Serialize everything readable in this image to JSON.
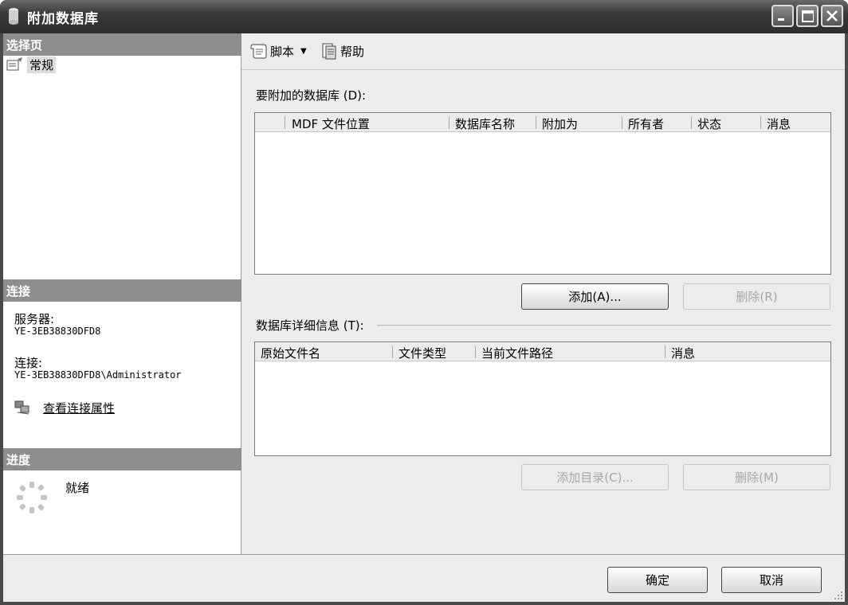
{
  "window": {
    "title": "附加数据库",
    "icon": "database-icon"
  },
  "left": {
    "select_page_header": "选择页",
    "nav_items": [
      {
        "label": "常规",
        "icon": "properties-icon"
      }
    ],
    "connection_header": "连接",
    "server_label": "服务器:",
    "server_value": "YE-3EB38830DFD8",
    "connection_label": "连接:",
    "connection_value": "YE-3EB38830DFD8\\Administrator",
    "view_connection_link": "查看连接属性",
    "progress_header": "进度",
    "progress_status": "就绪"
  },
  "toolbar": {
    "script_label": "脚本",
    "help_label": "帮助"
  },
  "databases_to_attach": {
    "label": "要附加的数据库 (D):",
    "columns": [
      "MDF 文件位置",
      "数据库名称",
      "附加为",
      "所有者",
      "状态",
      "消息"
    ],
    "rows": [],
    "add_button": "添加(A)...",
    "remove_button": "删除(R)"
  },
  "database_details": {
    "label": "数据库详细信息 (T):",
    "columns": [
      "原始文件名",
      "文件类型",
      "当前文件路径",
      "消息"
    ],
    "rows": [],
    "add_catalog_button": "添加目录(C)...",
    "remove_button": "删除(M)"
  },
  "footer": {
    "ok_button": "确定",
    "cancel_button": "取消"
  }
}
